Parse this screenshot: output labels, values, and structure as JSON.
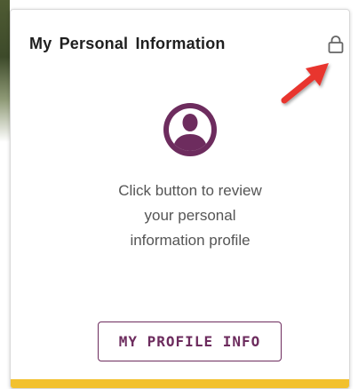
{
  "card": {
    "title": "My Personal Information",
    "lock_icon": "lock-icon",
    "avatar_icon": "user-avatar-icon",
    "description_lines": [
      "Click button to review",
      "your personal",
      "information profile"
    ],
    "button_label": "MY PROFILE INFO"
  },
  "colors": {
    "brand_purple": "#6d2c5e",
    "accent_yellow": "#f2c12e",
    "annotation_arrow": "#e8352f"
  }
}
